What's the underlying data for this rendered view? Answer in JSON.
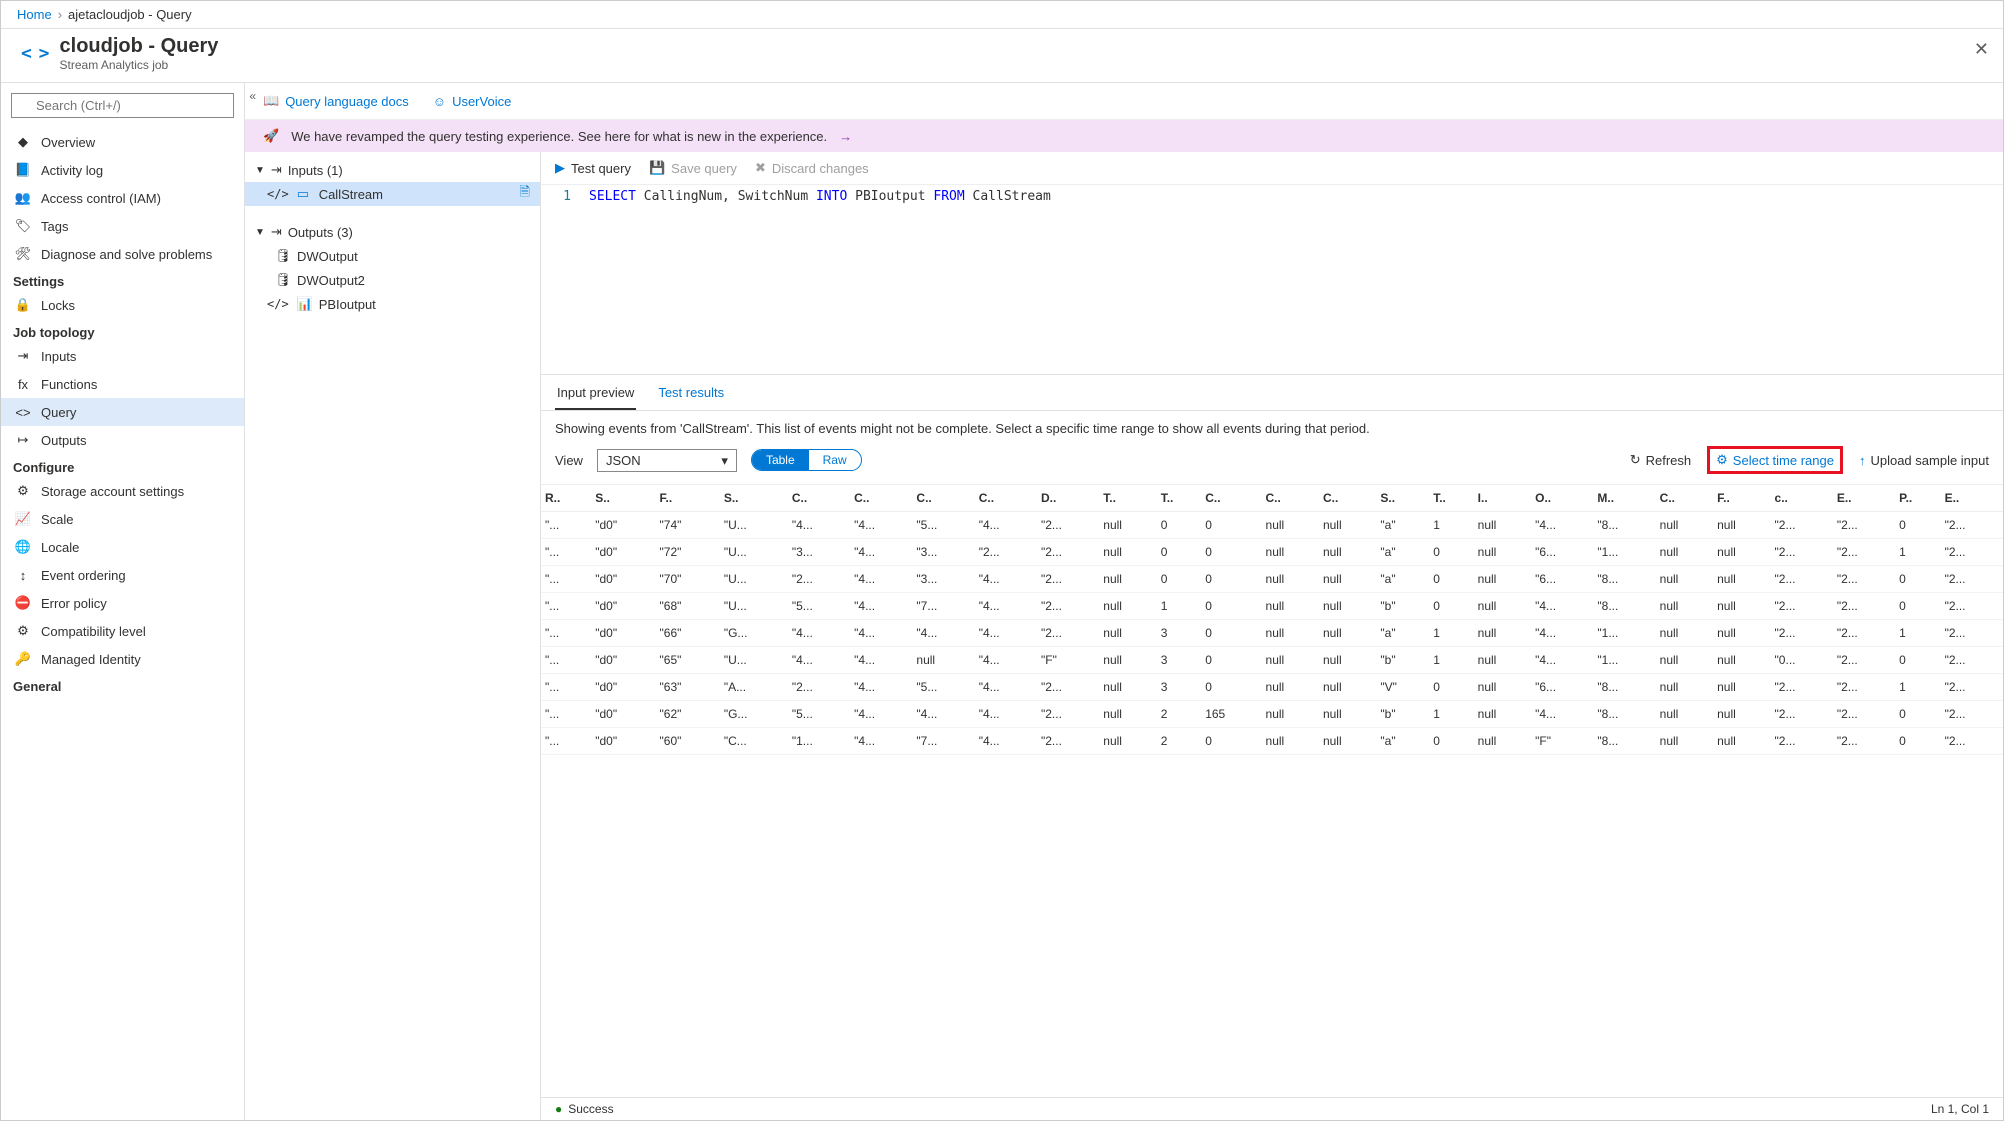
{
  "breadcrumb": {
    "home": "Home",
    "current": "ajetacloudjob - Query"
  },
  "title": {
    "icon": "< >",
    "heading": "cloudjob - Query",
    "subtitle": "Stream Analytics job"
  },
  "search": {
    "placeholder": "Search (Ctrl+/)"
  },
  "nav": {
    "top": [
      {
        "label": "Overview",
        "icon": "◆",
        "selected": false
      },
      {
        "label": "Activity log",
        "icon": "📘",
        "selected": false
      },
      {
        "label": "Access control (IAM)",
        "icon": "👥",
        "selected": false
      },
      {
        "label": "Tags",
        "icon": "🏷",
        "selected": false
      },
      {
        "label": "Diagnose and solve problems",
        "icon": "🛠",
        "selected": false
      }
    ],
    "sections": [
      {
        "title": "Settings",
        "items": [
          {
            "label": "Locks",
            "icon": "🔒"
          }
        ]
      },
      {
        "title": "Job topology",
        "items": [
          {
            "label": "Inputs",
            "icon": "⇥"
          },
          {
            "label": "Functions",
            "icon": "fx"
          },
          {
            "label": "Query",
            "icon": "<>",
            "selected": true
          },
          {
            "label": "Outputs",
            "icon": "↦"
          }
        ]
      },
      {
        "title": "Configure",
        "items": [
          {
            "label": "Storage account settings",
            "icon": "⚙"
          },
          {
            "label": "Scale",
            "icon": "📈"
          },
          {
            "label": "Locale",
            "icon": "🌐"
          },
          {
            "label": "Event ordering",
            "icon": "↕"
          },
          {
            "label": "Error policy",
            "icon": "⛔"
          },
          {
            "label": "Compatibility level",
            "icon": "⚙"
          },
          {
            "label": "Managed Identity",
            "icon": "🔑"
          }
        ]
      },
      {
        "title": "General",
        "items": []
      }
    ]
  },
  "topLinks": {
    "docs": "Query language docs",
    "uservoice": "UserVoice"
  },
  "banner": "We have revamped the query testing experience. See here for what is new in the experience.",
  "tree": {
    "inputs": {
      "label": "Inputs (1)",
      "items": [
        {
          "label": "CallStream",
          "selected": true,
          "hasDoc": true
        }
      ]
    },
    "outputs": {
      "label": "Outputs (3)",
      "items": [
        {
          "label": "DWOutput"
        },
        {
          "label": "DWOutput2"
        },
        {
          "label": "PBIoutput",
          "code": true
        }
      ]
    }
  },
  "toolbar": {
    "test": "Test query",
    "save": "Save query",
    "discard": "Discard changes"
  },
  "code": {
    "line": "1",
    "t1": "SELECT",
    "t2": " CallingNum, SwitchNum ",
    "t3": "INTO",
    "t4": " PBIoutput ",
    "t5": "FROM",
    "t6": " CallStream"
  },
  "preview": {
    "tabs": {
      "input": "Input preview",
      "results": "Test results"
    },
    "desc": "Showing events from 'CallStream'. This list of events might not be complete. Select a specific time range to show all events during that period.",
    "viewLabel": "View",
    "viewValue": "JSON",
    "seg": {
      "table": "Table",
      "raw": "Raw"
    },
    "refresh": "Refresh",
    "selectRange": "Select time range",
    "upload": "Upload sample input",
    "headers": [
      "R..",
      "S..",
      "F..",
      "S..",
      "C..",
      "C..",
      "C..",
      "C..",
      "D..",
      "T..",
      "T..",
      "C..",
      "C..",
      "C..",
      "S..",
      "T..",
      "I..",
      "O..",
      "M..",
      "C..",
      "F..",
      "c..",
      "E..",
      "P..",
      "E.."
    ],
    "rows": [
      [
        "\"...",
        "\"d0\"",
        "\"74\"",
        "\"U...",
        "\"4...",
        "\"4...",
        "\"5...",
        "\"4...",
        "\"2...",
        "null",
        "0",
        "0",
        "null",
        "null",
        "\"a\"",
        "1",
        "null",
        "\"4...",
        "\"8...",
        "null",
        "null",
        "\"2...",
        "\"2...",
        "0",
        "\"2..."
      ],
      [
        "\"...",
        "\"d0\"",
        "\"72\"",
        "\"U...",
        "\"3...",
        "\"4...",
        "\"3...",
        "\"2...",
        "\"2...",
        "null",
        "0",
        "0",
        "null",
        "null",
        "\"a\"",
        "0",
        "null",
        "\"6...",
        "\"1...",
        "null",
        "null",
        "\"2...",
        "\"2...",
        "1",
        "\"2..."
      ],
      [
        "\"...",
        "\"d0\"",
        "\"70\"",
        "\"U...",
        "\"2...",
        "\"4...",
        "\"3...",
        "\"4...",
        "\"2...",
        "null",
        "0",
        "0",
        "null",
        "null",
        "\"a\"",
        "0",
        "null",
        "\"6...",
        "\"8...",
        "null",
        "null",
        "\"2...",
        "\"2...",
        "0",
        "\"2..."
      ],
      [
        "\"...",
        "\"d0\"",
        "\"68\"",
        "\"U...",
        "\"5...",
        "\"4...",
        "\"7...",
        "\"4...",
        "\"2...",
        "null",
        "1",
        "0",
        "null",
        "null",
        "\"b\"",
        "0",
        "null",
        "\"4...",
        "\"8...",
        "null",
        "null",
        "\"2...",
        "\"2...",
        "0",
        "\"2..."
      ],
      [
        "\"...",
        "\"d0\"",
        "\"66\"",
        "\"G...",
        "\"4...",
        "\"4...",
        "\"4...",
        "\"4...",
        "\"2...",
        "null",
        "3",
        "0",
        "null",
        "null",
        "\"a\"",
        "1",
        "null",
        "\"4...",
        "\"1...",
        "null",
        "null",
        "\"2...",
        "\"2...",
        "1",
        "\"2..."
      ],
      [
        "\"...",
        "\"d0\"",
        "\"65\"",
        "\"U...",
        "\"4...",
        "\"4...",
        "null",
        "\"4...",
        "\"F\"",
        "null",
        "3",
        "0",
        "null",
        "null",
        "\"b\"",
        "1",
        "null",
        "\"4...",
        "\"1...",
        "null",
        "null",
        "\"0...",
        "\"2...",
        "0",
        "\"2..."
      ],
      [
        "\"...",
        "\"d0\"",
        "\"63\"",
        "\"A...",
        "\"2...",
        "\"4...",
        "\"5...",
        "\"4...",
        "\"2...",
        "null",
        "3",
        "0",
        "null",
        "null",
        "\"V\"",
        "0",
        "null",
        "\"6...",
        "\"8...",
        "null",
        "null",
        "\"2...",
        "\"2...",
        "1",
        "\"2..."
      ],
      [
        "\"...",
        "\"d0\"",
        "\"62\"",
        "\"G...",
        "\"5...",
        "\"4...",
        "\"4...",
        "\"4...",
        "\"2...",
        "null",
        "2",
        "165",
        "null",
        "null",
        "\"b\"",
        "1",
        "null",
        "\"4...",
        "\"8...",
        "null",
        "null",
        "\"2...",
        "\"2...",
        "0",
        "\"2..."
      ],
      [
        "\"...",
        "\"d0\"",
        "\"60\"",
        "\"C...",
        "\"1...",
        "\"4...",
        "\"7...",
        "\"4...",
        "\"2...",
        "null",
        "2",
        "0",
        "null",
        "null",
        "\"a\"",
        "0",
        "null",
        "\"F\"",
        "\"8...",
        "null",
        "null",
        "\"2...",
        "\"2...",
        "0",
        "\"2..."
      ]
    ],
    "status": "Success",
    "cursor": "Ln 1, Col 1"
  }
}
